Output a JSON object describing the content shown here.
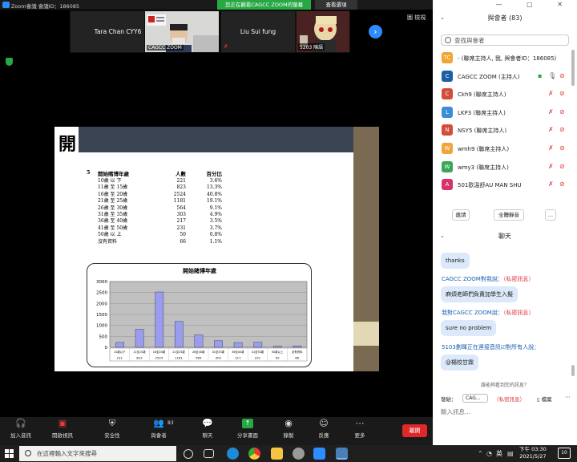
{
  "zoom": {
    "title": "Zoom會議 會議ID：186085",
    "share_banner": "您正在觀看CAGCC ZOOM的螢幕",
    "view_options": "查看選項",
    "gallery": "圖 檢視"
  },
  "video": {
    "tiles": [
      {
        "name": "Tara Chan CYY6",
        "label": ""
      },
      {
        "name": "",
        "label": "CAGCC ZOOM"
      },
      {
        "name": "Liu Sui fung",
        "label": ""
      },
      {
        "name": "",
        "label": "5203 陳語"
      }
    ]
  },
  "slide": {
    "header_char": "開",
    "table_number": "5",
    "headers": [
      "開始賭博年歲",
      "人數",
      "百分比"
    ],
    "rows": [
      [
        "10歲 以 下",
        "221",
        "3.6%"
      ],
      [
        "11歲 至 15歲",
        "823",
        "13.3%"
      ],
      [
        "16歲 至 20歲",
        "2524",
        "40.8%"
      ],
      [
        "21歲 至 25歲",
        "1181",
        "19.1%"
      ],
      [
        "26歲 至 30歲",
        "564",
        "9.1%"
      ],
      [
        "31歲 至 35歲",
        "303",
        "4.9%"
      ],
      [
        "36歲 至 40歲",
        "217",
        "3.5%"
      ],
      [
        "41歲 至 50歲",
        "231",
        "3.7%"
      ],
      [
        "50歲 以 上",
        "50",
        "0.8%"
      ],
      [
        "沒有資料",
        "66",
        "1.1%"
      ]
    ]
  },
  "chart_data": {
    "type": "bar",
    "title": "開始賭博年歲",
    "categories": [
      "10歲以下",
      "11至15歲",
      "16至20歲",
      "21至25歲",
      "26至30歲",
      "31至35歲",
      "36至40歲",
      "41至50歲",
      "50歲以上",
      "沒有資料"
    ],
    "values": [
      221,
      823,
      2524,
      1181,
      564,
      303,
      217,
      231,
      50,
      66
    ],
    "y_ticks": [
      "0",
      "500",
      "1000",
      "1500",
      "2000",
      "2500",
      "3000"
    ],
    "ylim": [
      0,
      3000
    ],
    "grid": true,
    "bar_color": "#9a9cf0"
  },
  "toolbar": {
    "join_audio": "加入音訊",
    "start_video": "開啟視訊",
    "security": "安全性",
    "participants": "與會者",
    "participants_count": "83",
    "chat": "聊天",
    "share": "分享畫面",
    "record": "錄製",
    "reactions": "反應",
    "more": "更多",
    "end": "離開"
  },
  "panel": {
    "window_controls": "— ▢ ✕",
    "participants_header": "與會者 (83)",
    "search_placeholder": "查找與會者",
    "participants": [
      {
        "initials": "TC",
        "name": "- (聯席主持人, 我, 與會者ID：186085)",
        "color": "#f3a531"
      },
      {
        "initials": "C",
        "name": "CAGCC ZOOM (主持人)",
        "color": "#1a5fa8"
      },
      {
        "initials": "C",
        "name": "Ckh9 (聯席主持人)",
        "color": "#d24d3a"
      },
      {
        "initials": "L",
        "name": "LKP3 (聯席主持人)",
        "color": "#3a8dd6"
      },
      {
        "initials": "N",
        "name": "NSY5 (聯席主持人)",
        "color": "#d24d3a"
      },
      {
        "initials": "W",
        "name": "wmh9 (聯席主持人)",
        "color": "#f0a43a"
      },
      {
        "initials": "W",
        "name": "wmy3 (聯席主持人)",
        "color": "#3aa655"
      },
      {
        "initials": "A",
        "name": "501歐溫舒AU MAN SHU",
        "color": "#d6336c"
      }
    ],
    "invite": "邀請",
    "mute_all": "全體靜音",
    "more": "...",
    "chat_header": "聊天",
    "chat": {
      "msg1": "thanks",
      "line2_prefix": "CAGCC ZOOM對我說：",
      "line2_priv": "（私密訊息）",
      "msg2": "麻煩老師們負責加學生入擬",
      "line3_prefix": "我對CAGCC ZOOM說：",
      "line3_priv": "（私密訊息）",
      "msg3": "sure no problem",
      "line4": "5103劃暉正在連接音訊☑對所有人說：",
      "msg4": "@楊校甘霖"
    },
    "who_can_see": "誰能夠看到您的訊息？",
    "send_to_label": "發給：",
    "send_to_value": "CAG...",
    "send_priv": "（私密訊息）",
    "file_label": "檔案",
    "input_placeholder": "輸入訊息..."
  },
  "taskbar": {
    "search_placeholder": "在這裡輸入文字來搜尋",
    "ime": "英",
    "time": "下午 03:30",
    "date": "2021/5/27",
    "notifications": "10"
  }
}
